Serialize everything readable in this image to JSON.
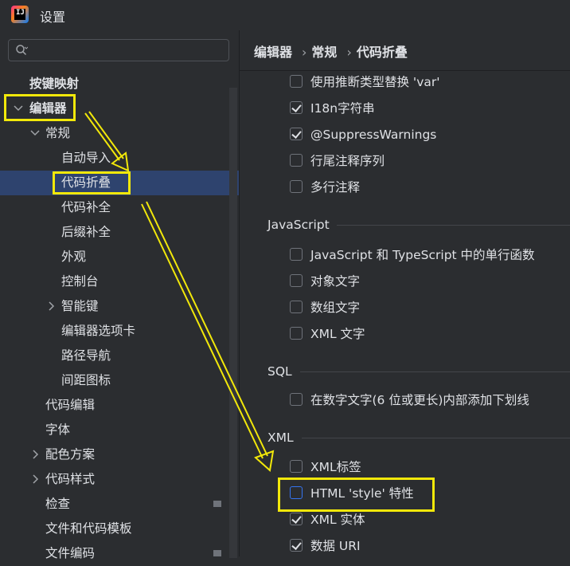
{
  "window": {
    "title": "设置",
    "app_icon": "intellij-idea-icon"
  },
  "sidebar": {
    "search_placeholder": "",
    "items": [
      {
        "label": "按键映射",
        "level": 0,
        "bold": true
      },
      {
        "label": "编辑器",
        "level": 0,
        "bold": true,
        "expanded": true
      },
      {
        "label": "常规",
        "level": 1,
        "expanded": true
      },
      {
        "label": "自动导入",
        "level": 2
      },
      {
        "label": "代码折叠",
        "level": 2,
        "selected": true
      },
      {
        "label": "代码补全",
        "level": 2
      },
      {
        "label": "后缀补全",
        "level": 2
      },
      {
        "label": "外观",
        "level": 2
      },
      {
        "label": "控制台",
        "level": 2
      },
      {
        "label": "智能键",
        "level": 2,
        "collapsed": true
      },
      {
        "label": "编辑器选项卡",
        "level": 2
      },
      {
        "label": "路径导航",
        "level": 2
      },
      {
        "label": "间距图标",
        "level": 2
      },
      {
        "label": "代码编辑",
        "level": 1
      },
      {
        "label": "字体",
        "level": 1
      },
      {
        "label": "配色方案",
        "level": 1,
        "collapsed": true
      },
      {
        "label": "代码样式",
        "level": 1,
        "collapsed": true
      },
      {
        "label": "检查",
        "level": 1,
        "marker": true
      },
      {
        "label": "文件和代码模板",
        "level": 1
      },
      {
        "label": "文件编码",
        "level": 1,
        "marker": true
      }
    ]
  },
  "breadcrumb": {
    "parts": [
      "编辑器",
      "常规",
      "代码折叠"
    ],
    "separator": "›"
  },
  "options": {
    "top": [
      {
        "label": "使用推断类型替换 'var'",
        "checked": false
      },
      {
        "label": "I18n字符串",
        "checked": true
      },
      {
        "label": "@SuppressWarnings",
        "checked": true
      },
      {
        "label": "行尾注释序列",
        "checked": false
      },
      {
        "label": "多行注释",
        "checked": false
      }
    ],
    "javascript": {
      "title": "JavaScript",
      "items": [
        {
          "label": "JavaScript 和 TypeScript 中的单行函数",
          "checked": false
        },
        {
          "label": "对象文字",
          "checked": false
        },
        {
          "label": "数组文字",
          "checked": false
        },
        {
          "label": "XML 文字",
          "checked": false
        }
      ]
    },
    "sql": {
      "title": "SQL",
      "items": [
        {
          "label": "在数字文字(6 位或更长)内部添加下划线",
          "checked": false
        }
      ]
    },
    "xml": {
      "title": "XML",
      "items": [
        {
          "label": "XML标签",
          "checked": false
        },
        {
          "label": "HTML 'style' 特性",
          "checked": false
        },
        {
          "label": "XML 实体",
          "checked": true
        },
        {
          "label": "数据 URI",
          "checked": true
        }
      ]
    }
  },
  "colors": {
    "highlight": "#f2e80a",
    "selection": "#2e436e",
    "background": "#2b2d30"
  }
}
